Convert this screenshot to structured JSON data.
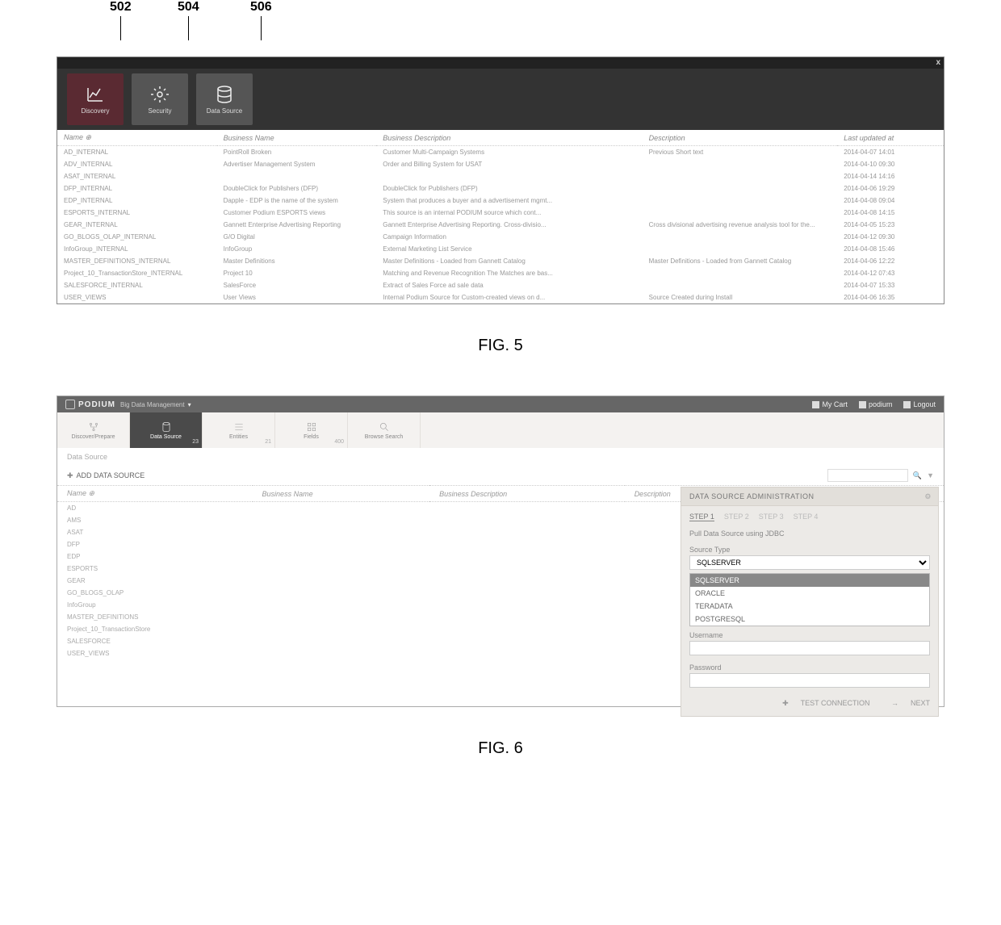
{
  "callouts": {
    "a": "502",
    "b": "504",
    "c": "506"
  },
  "fig5": {
    "tiles": {
      "discovery": "Discovery",
      "security": "Security",
      "datasource": "Data Source"
    },
    "close": "x",
    "columns": {
      "name": "Name",
      "sort": "⊕",
      "bname": "Business Name",
      "bdesc": "Business Description",
      "desc": "Description",
      "updated": "Last updated at"
    },
    "rows": [
      {
        "name": "AD_INTERNAL",
        "bname": "PointRoll Broken",
        "bdesc": "Customer Multi-Campaign Systems",
        "desc": "Previous Short text",
        "updated": "2014-04-07 14:01"
      },
      {
        "name": "ADV_INTERNAL",
        "bname": "Advertiser Management System",
        "bdesc": "Order and Billing System for USAT",
        "desc": "",
        "updated": "2014-04-10 09:30"
      },
      {
        "name": "ASAT_INTERNAL",
        "bname": "",
        "bdesc": "",
        "desc": "",
        "updated": "2014-04-14 14:16"
      },
      {
        "name": "DFP_INTERNAL",
        "bname": "DoubleClick for Publishers (DFP)",
        "bdesc": "DoubleClick for Publishers (DFP)",
        "desc": "",
        "updated": "2014-04-06 19:29"
      },
      {
        "name": "EDP_INTERNAL",
        "bname": "Dapple - EDP is the name of the system",
        "bdesc": "System that produces a buyer and a advertisement mgmt...",
        "desc": "",
        "updated": "2014-04-08 09:04"
      },
      {
        "name": "ESPORTS_INTERNAL",
        "bname": "Customer Podium ESPORTS views",
        "bdesc": "This source is an internal PODIUM source which cont...",
        "desc": "",
        "updated": "2014-04-08 14:15"
      },
      {
        "name": "GEAR_INTERNAL",
        "bname": "Gannett Enterprise Advertising Reporting",
        "bdesc": "Gannett Enterprise Advertising Reporting. Cross-divisio...",
        "desc": "Cross divisional advertising revenue analysis tool for the...",
        "updated": "2014-04-05 15:23"
      },
      {
        "name": "GO_BLOGS_OLAP_INTERNAL",
        "bname": "G/O Digital",
        "bdesc": "Campaign Information",
        "desc": "",
        "updated": "2014-04-12 09:30"
      },
      {
        "name": "InfoGroup_INTERNAL",
        "bname": "InfoGroup",
        "bdesc": "External Marketing List Service",
        "desc": "",
        "updated": "2014-04-08 15:46"
      },
      {
        "name": "MASTER_DEFINITIONS_INTERNAL",
        "bname": "Master Definitions",
        "bdesc": "Master Definitions - Loaded from Gannett Catalog",
        "desc": "Master Definitions - Loaded from Gannett Catalog",
        "updated": "2014-04-06 12:22"
      },
      {
        "name": "Project_10_TransactionStore_INTERNAL",
        "bname": "Project 10",
        "bdesc": "Matching and Revenue Recognition The Matches are bas...",
        "desc": "",
        "updated": "2014-04-12 07:43"
      },
      {
        "name": "SALESFORCE_INTERNAL",
        "bname": "SalesForce",
        "bdesc": "Extract of Sales Force ad sale data",
        "desc": "",
        "updated": "2014-04-07 15:33"
      },
      {
        "name": "USER_VIEWS",
        "bname": "User Views",
        "bdesc": "Internal Podium Source for Custom-created views on d...",
        "desc": "Source Created during Install",
        "updated": "2014-04-06 16:35"
      }
    ]
  },
  "fig5_label": "FIG. 5",
  "fig6": {
    "header": {
      "brand": "PODIUM",
      "subtitle": "Big Data Management",
      "dropdown": "▾",
      "mycart": "My Cart",
      "user": "podium",
      "logout": "Logout"
    },
    "nav": {
      "discovery": {
        "label": "Discover/Prepare",
        "badge": ""
      },
      "datasource": {
        "label": "Data Source",
        "badge": "23"
      },
      "entities": {
        "label": "Entities",
        "badge": "21"
      },
      "fields": {
        "label": "Fields",
        "badge": "400"
      },
      "search": {
        "label": "Browse Search",
        "badge": ""
      }
    },
    "breadcrumb": "Data Source",
    "add_label": "ADD DATA SOURCE",
    "search_placeholder": "",
    "columns": {
      "name": "Name",
      "sort": "⊕",
      "bname": "Business Name",
      "bdesc": "Business Description",
      "desc": "Description"
    },
    "rows": [
      {
        "name": "AD"
      },
      {
        "name": "AMS"
      },
      {
        "name": "ASAT"
      },
      {
        "name": "DFP"
      },
      {
        "name": "EDP"
      },
      {
        "name": "ESPORTS"
      },
      {
        "name": "GEAR"
      },
      {
        "name": "GO_BLOGS_OLAP"
      },
      {
        "name": "InfoGroup"
      },
      {
        "name": "MASTER_DEFINITIONS"
      },
      {
        "name": "Project_10_TransactionStore"
      },
      {
        "name": "SALESFORCE"
      },
      {
        "name": "USER_VIEWS"
      }
    ],
    "admin": {
      "title": "DATA SOURCE ADMINISTRATION",
      "steps": {
        "s1": "STEP 1",
        "s2": "STEP 2",
        "s3": "STEP 3",
        "s4": "STEP 4"
      },
      "pull_label": "Pull Data Source using JDBC",
      "source_type_label": "Source Type",
      "source_type_selected": "SQLSERVER",
      "options": {
        "o1": "SQLSERVER",
        "o2": "ORACLE",
        "o3": "TERADATA",
        "o4": "POSTGRESQL"
      },
      "username_label": "Username",
      "username_value": "",
      "password_label": "Password",
      "password_value": "",
      "test": "TEST CONNECTION",
      "next": "NEXT"
    }
  },
  "fig6_label": "FIG. 6"
}
